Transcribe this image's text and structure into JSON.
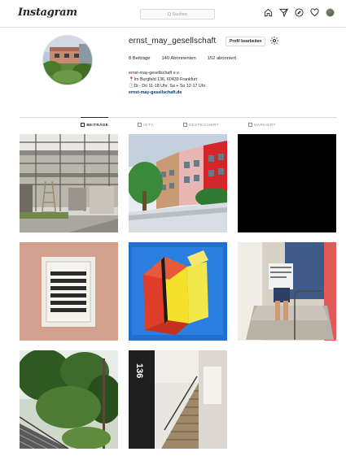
{
  "app": {
    "logo": "Instagram"
  },
  "search": {
    "placeholder": "Q Suchen"
  },
  "nav": {
    "icons": [
      "home-icon",
      "direct-icon",
      "explore-icon",
      "heart-icon",
      "profile-avatar"
    ]
  },
  "profile": {
    "username": "ernst_may_gesellschaft",
    "edit_label": "Profil bearbeiten",
    "stats": {
      "posts": "8 Beiträge",
      "followers": "140 Abonnenten",
      "following": "152 abonniert"
    },
    "bio": {
      "name": "ernst-may-gesellschaft e.v.",
      "address": "📍Im Burgfeld 136, 60439 Frankfurt",
      "hours": "🕐Di - Do 11-18 Uhr, Sa + So 12-17 Uhr",
      "website": "ernst-may-gesellschaft.de"
    }
  },
  "tabs": [
    {
      "label": "BEITRÄGE",
      "active": true
    },
    {
      "label": "IGTV",
      "active": false
    },
    {
      "label": "GESPEICHERT",
      "active": false
    },
    {
      "label": "MARKIERT",
      "active": false
    }
  ],
  "posts": [
    "scaffolding-building",
    "colorful-houses-painting",
    "black-square",
    "vent-grille-pink-wall",
    "yellow-door-illustration",
    "person-reading-on-steps",
    "garden-stairs",
    "stairwell-136"
  ],
  "stairwell_number": "136"
}
